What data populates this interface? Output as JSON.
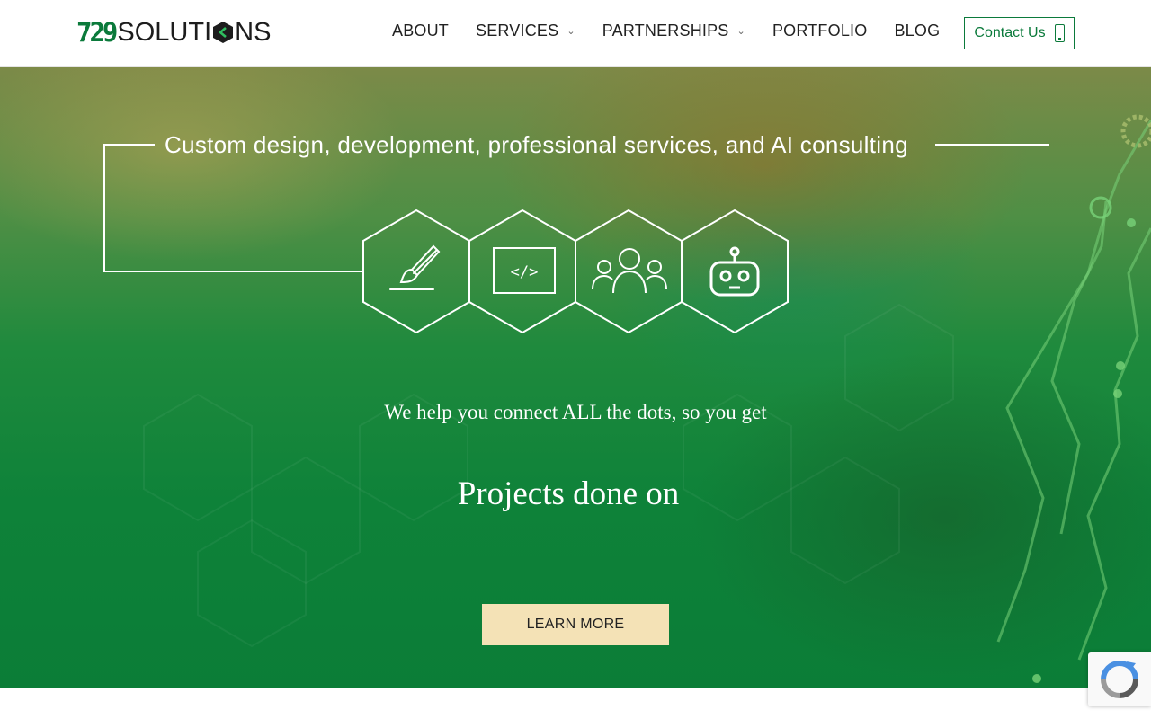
{
  "header": {
    "logo_number": "729",
    "logo_word_a": "SOLUTI",
    "logo_word_b": "NS",
    "nav": [
      {
        "label": "ABOUT",
        "has_dropdown": false
      },
      {
        "label": "SERVICES",
        "has_dropdown": true
      },
      {
        "label": "PARTNERSHIPS",
        "has_dropdown": true
      },
      {
        "label": "PORTFOLIO",
        "has_dropdown": false
      },
      {
        "label": "BLOG",
        "has_dropdown": false
      }
    ],
    "contact_label": "Contact Us",
    "contact_icon": "phone-icon"
  },
  "hero": {
    "tagline": "Custom design, development, professional services, and AI consulting",
    "icons": [
      "paintbrush-icon",
      "code-icon",
      "people-icon",
      "robot-icon"
    ],
    "subheading": "We help you connect ALL the dots, so you get",
    "headline": "Projects done on",
    "cta_label": "LEARN MORE"
  },
  "colors": {
    "brand_green": "#0b7a3b",
    "cta_background": "#f4e2b6"
  },
  "recaptcha": {
    "icon": "recaptcha-icon"
  }
}
